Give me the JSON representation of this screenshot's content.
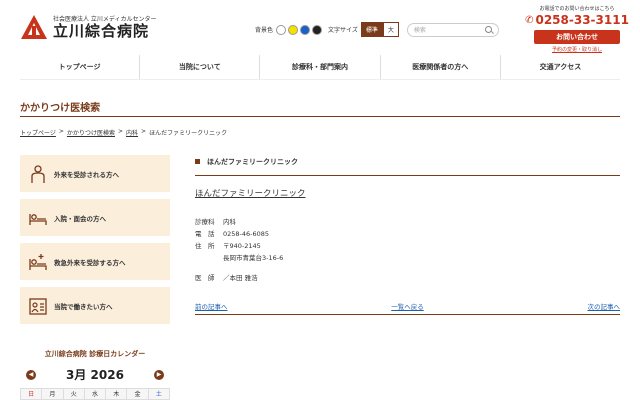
{
  "header": {
    "org": "社会医療法人 立川メディカルセンター",
    "name": "立川綜合病院",
    "bg_label": "背景色",
    "bg_colors": [
      "#ffffff",
      "#f5e000",
      "#1b5fc8",
      "#222222"
    ],
    "font_size_label": "文字サイズ",
    "size_standard": "標準",
    "size_large": "大",
    "search_placeholder": "検索",
    "contact_note": "お電話でのお問い合わせはこちら",
    "phone": "0258-33-3111",
    "inquiry": "お問い合わせ",
    "reserve": "予約の変更・取り消し"
  },
  "nav": [
    "トップページ",
    "当院について",
    "診療科・部門案内",
    "医療関係者の方へ",
    "交通アクセス"
  ],
  "page": {
    "title": "かかりつけ医検索",
    "breadcrumb": [
      "トップページ",
      "かかりつけ医検索",
      "内科",
      "ほんだファミリークリニック"
    ]
  },
  "side": [
    {
      "label": "外来を受診される方へ",
      "icon": "outpatient-icon"
    },
    {
      "label": "入院・面会の方へ",
      "icon": "inpatient-bed-icon"
    },
    {
      "label": "救急外来を受診する方へ",
      "icon": "emergency-bed-icon"
    },
    {
      "label": "当院で働きたい方へ",
      "icon": "job-board-icon"
    }
  ],
  "calendar": {
    "title": "立川綜合病院 診療日カレンダー",
    "month": "3月 2026",
    "days": [
      "日",
      "月",
      "火",
      "水",
      "木",
      "金",
      "土"
    ]
  },
  "clinic": {
    "section": "ほんだファミリークリニック",
    "name": "ほんだファミリークリニック",
    "dept_label": "診療科",
    "dept": "内科",
    "tel_label": "電　話",
    "tel": "0258-46-6085",
    "addr_label": "住　所",
    "zip": "〒940-2145",
    "addr": "長岡市青葉台3-16-6",
    "doctor_label": "医　師",
    "doctor": "／本田 雅浩"
  },
  "pager": {
    "prev": "前の記事へ",
    "list": "一覧へ戻る",
    "next": "次の記事へ"
  },
  "colors": {
    "brand": "#7a3b1b",
    "accent": "#c8331b",
    "side_bg": "#fbeedb",
    "link": "#1f5fb0"
  }
}
